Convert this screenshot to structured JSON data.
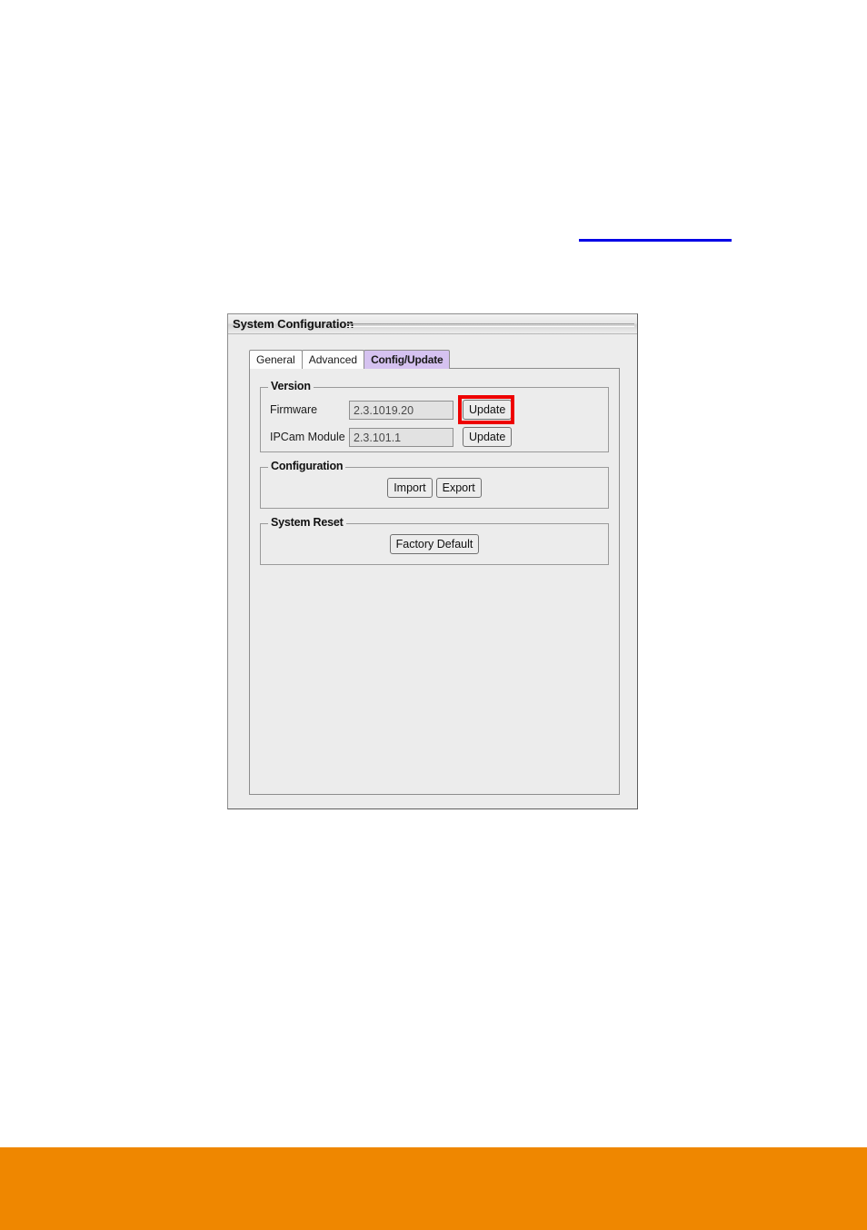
{
  "page": {
    "background_color": "#ffffff",
    "footer_band_color": "#ef8700",
    "link_color": "#0000e6",
    "link_text": ""
  },
  "dialog": {
    "title": "System Configuration",
    "background_color": "#ececec"
  },
  "tabs": [
    {
      "label": "General",
      "selected": false
    },
    {
      "label": "Advanced",
      "selected": false
    },
    {
      "label": "Config/Update",
      "selected": true
    }
  ],
  "groups": {
    "version": {
      "title": "Version",
      "rows": [
        {
          "label": "Firmware",
          "value": "2.3.1019.20",
          "button_label": "Update",
          "highlighted": true
        },
        {
          "label": "IPCam Module",
          "value": "2.3.101.1",
          "button_label": "Update",
          "highlighted": false
        }
      ]
    },
    "configuration": {
      "title": "Configuration",
      "buttons": [
        {
          "label": "Import"
        },
        {
          "label": "Export"
        }
      ]
    },
    "system_reset": {
      "title": "System Reset",
      "buttons": [
        {
          "label": "Factory Default"
        }
      ]
    }
  },
  "annotation": {
    "highlight_color": "#ee0000",
    "target": "firmware-update-button"
  }
}
